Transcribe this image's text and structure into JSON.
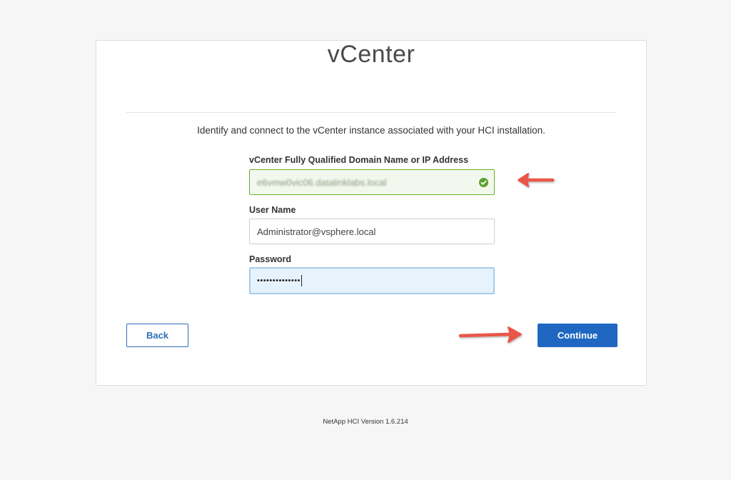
{
  "card": {
    "title": "vCenter",
    "subtitle": "Identify and connect to the vCenter instance associated with your HCI installation."
  },
  "form": {
    "fqdn_label": "vCenter Fully Qualified Domain Name or IP Address",
    "fqdn_value": "e6vmw0vic06.datalinklabs.local",
    "fqdn_status_icon": "check-circle-icon",
    "username_label": "User Name",
    "username_value": "Administrator@vsphere.local",
    "password_label": "Password",
    "password_masked": "••••••••••••••"
  },
  "buttons": {
    "back_label": "Back",
    "continue_label": "Continue"
  },
  "footer": {
    "version_text": "NetApp HCI Version 1.6.214"
  },
  "colors": {
    "primary": "#1f67c0",
    "valid_border": "#6bb22a",
    "focus_bg": "#e6f2fc",
    "annotation_arrow": "#e8564a"
  }
}
